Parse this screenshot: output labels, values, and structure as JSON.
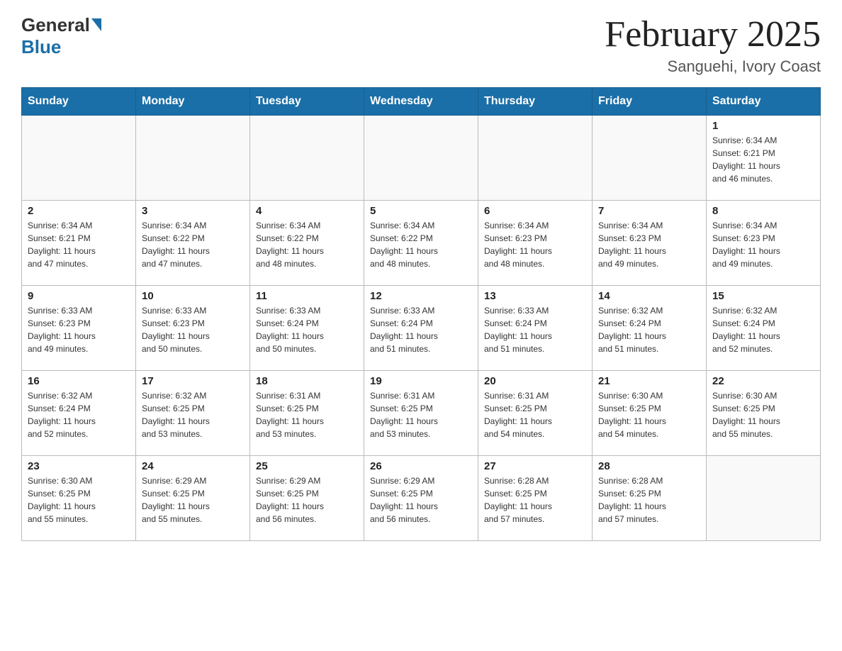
{
  "header": {
    "logo_general": "General",
    "logo_blue": "Blue",
    "month_title": "February 2025",
    "location": "Sanguehi, Ivory Coast"
  },
  "weekdays": [
    "Sunday",
    "Monday",
    "Tuesday",
    "Wednesday",
    "Thursday",
    "Friday",
    "Saturday"
  ],
  "weeks": [
    [
      {
        "day": "",
        "info": ""
      },
      {
        "day": "",
        "info": ""
      },
      {
        "day": "",
        "info": ""
      },
      {
        "day": "",
        "info": ""
      },
      {
        "day": "",
        "info": ""
      },
      {
        "day": "",
        "info": ""
      },
      {
        "day": "1",
        "info": "Sunrise: 6:34 AM\nSunset: 6:21 PM\nDaylight: 11 hours\nand 46 minutes."
      }
    ],
    [
      {
        "day": "2",
        "info": "Sunrise: 6:34 AM\nSunset: 6:21 PM\nDaylight: 11 hours\nand 47 minutes."
      },
      {
        "day": "3",
        "info": "Sunrise: 6:34 AM\nSunset: 6:22 PM\nDaylight: 11 hours\nand 47 minutes."
      },
      {
        "day": "4",
        "info": "Sunrise: 6:34 AM\nSunset: 6:22 PM\nDaylight: 11 hours\nand 48 minutes."
      },
      {
        "day": "5",
        "info": "Sunrise: 6:34 AM\nSunset: 6:22 PM\nDaylight: 11 hours\nand 48 minutes."
      },
      {
        "day": "6",
        "info": "Sunrise: 6:34 AM\nSunset: 6:23 PM\nDaylight: 11 hours\nand 48 minutes."
      },
      {
        "day": "7",
        "info": "Sunrise: 6:34 AM\nSunset: 6:23 PM\nDaylight: 11 hours\nand 49 minutes."
      },
      {
        "day": "8",
        "info": "Sunrise: 6:34 AM\nSunset: 6:23 PM\nDaylight: 11 hours\nand 49 minutes."
      }
    ],
    [
      {
        "day": "9",
        "info": "Sunrise: 6:33 AM\nSunset: 6:23 PM\nDaylight: 11 hours\nand 49 minutes."
      },
      {
        "day": "10",
        "info": "Sunrise: 6:33 AM\nSunset: 6:23 PM\nDaylight: 11 hours\nand 50 minutes."
      },
      {
        "day": "11",
        "info": "Sunrise: 6:33 AM\nSunset: 6:24 PM\nDaylight: 11 hours\nand 50 minutes."
      },
      {
        "day": "12",
        "info": "Sunrise: 6:33 AM\nSunset: 6:24 PM\nDaylight: 11 hours\nand 51 minutes."
      },
      {
        "day": "13",
        "info": "Sunrise: 6:33 AM\nSunset: 6:24 PM\nDaylight: 11 hours\nand 51 minutes."
      },
      {
        "day": "14",
        "info": "Sunrise: 6:32 AM\nSunset: 6:24 PM\nDaylight: 11 hours\nand 51 minutes."
      },
      {
        "day": "15",
        "info": "Sunrise: 6:32 AM\nSunset: 6:24 PM\nDaylight: 11 hours\nand 52 minutes."
      }
    ],
    [
      {
        "day": "16",
        "info": "Sunrise: 6:32 AM\nSunset: 6:24 PM\nDaylight: 11 hours\nand 52 minutes."
      },
      {
        "day": "17",
        "info": "Sunrise: 6:32 AM\nSunset: 6:25 PM\nDaylight: 11 hours\nand 53 minutes."
      },
      {
        "day": "18",
        "info": "Sunrise: 6:31 AM\nSunset: 6:25 PM\nDaylight: 11 hours\nand 53 minutes."
      },
      {
        "day": "19",
        "info": "Sunrise: 6:31 AM\nSunset: 6:25 PM\nDaylight: 11 hours\nand 53 minutes."
      },
      {
        "day": "20",
        "info": "Sunrise: 6:31 AM\nSunset: 6:25 PM\nDaylight: 11 hours\nand 54 minutes."
      },
      {
        "day": "21",
        "info": "Sunrise: 6:30 AM\nSunset: 6:25 PM\nDaylight: 11 hours\nand 54 minutes."
      },
      {
        "day": "22",
        "info": "Sunrise: 6:30 AM\nSunset: 6:25 PM\nDaylight: 11 hours\nand 55 minutes."
      }
    ],
    [
      {
        "day": "23",
        "info": "Sunrise: 6:30 AM\nSunset: 6:25 PM\nDaylight: 11 hours\nand 55 minutes."
      },
      {
        "day": "24",
        "info": "Sunrise: 6:29 AM\nSunset: 6:25 PM\nDaylight: 11 hours\nand 55 minutes."
      },
      {
        "day": "25",
        "info": "Sunrise: 6:29 AM\nSunset: 6:25 PM\nDaylight: 11 hours\nand 56 minutes."
      },
      {
        "day": "26",
        "info": "Sunrise: 6:29 AM\nSunset: 6:25 PM\nDaylight: 11 hours\nand 56 minutes."
      },
      {
        "day": "27",
        "info": "Sunrise: 6:28 AM\nSunset: 6:25 PM\nDaylight: 11 hours\nand 57 minutes."
      },
      {
        "day": "28",
        "info": "Sunrise: 6:28 AM\nSunset: 6:25 PM\nDaylight: 11 hours\nand 57 minutes."
      },
      {
        "day": "",
        "info": ""
      }
    ]
  ]
}
